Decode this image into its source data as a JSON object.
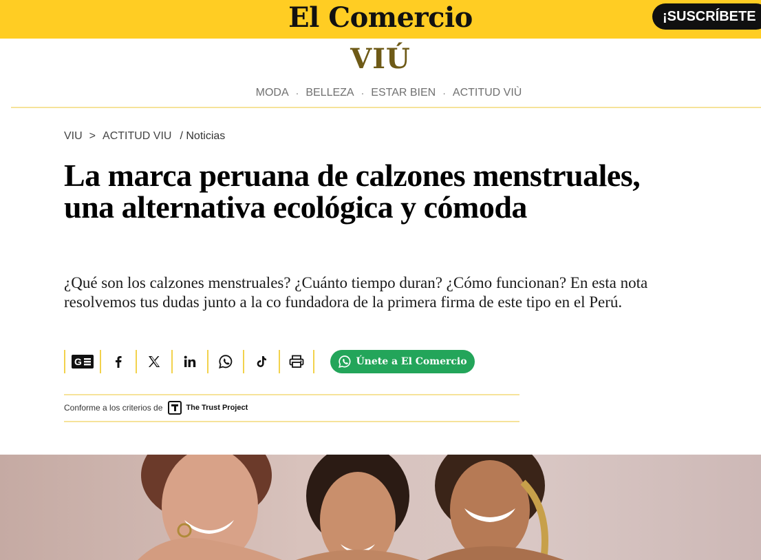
{
  "header": {
    "brand": "El Comercio",
    "subscribe_label": "¡SUSCRÍBETE"
  },
  "section": {
    "title": "VIÚ",
    "nav": [
      "MODA",
      "BELLEZA",
      "ESTAR BIEN",
      "ACTITUD VIÙ"
    ],
    "separator": "·"
  },
  "breadcrumb": {
    "items": [
      "VIU",
      "ACTITUD VIU"
    ],
    "separator": ">",
    "current": "/ Noticias"
  },
  "article": {
    "headline": "La marca peruana de calzones menstruales, una alternativa ecológica y cómoda",
    "dek": "¿Qué son los calzones menstruales? ¿Cuánto tiempo duran? ¿Cómo funcionan? En esta nota resolvemos tus dudas junto a la co fundadora de la primera firma de este tipo en el Perú."
  },
  "share": {
    "buttons": [
      "google-news-icon",
      "facebook-icon",
      "x-icon",
      "linkedin-icon",
      "whatsapp-icon",
      "tiktok-icon",
      "print-icon"
    ],
    "join_label": "Únete a El Comercio"
  },
  "trust": {
    "prefix": "Conforme a los criterios de",
    "name": "The Trust Project"
  },
  "colors": {
    "header_yellow": "#ffcd23",
    "section_gold": "#6e5a17",
    "rule_yellow": "#f6e39a",
    "whatsapp_green": "#23a55a"
  }
}
